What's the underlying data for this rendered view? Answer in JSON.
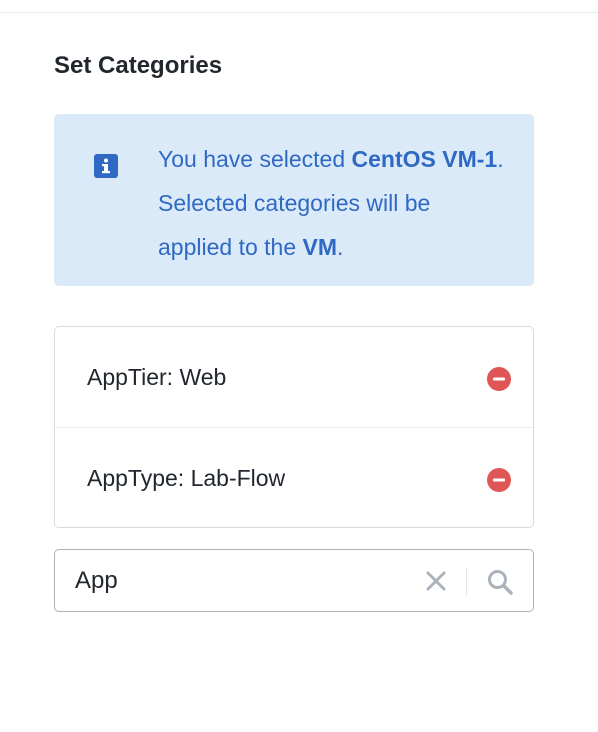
{
  "panel": {
    "title": "Set Categories"
  },
  "info": {
    "icon": "info-icon",
    "text_part1": "You have selected ",
    "vm_name": "CentOS VM-1",
    "text_part2": ". Selected categories will be applied to the ",
    "entity_type": "VM",
    "text_part3": ".",
    "background_color": "#daeaf9",
    "text_color": "#2f69c4"
  },
  "categories": [
    {
      "label": "AppTier: Web",
      "remove_icon": "remove-circle-icon"
    },
    {
      "label": "AppType: Lab-Flow",
      "remove_icon": "remove-circle-icon"
    }
  ],
  "search": {
    "value": "App",
    "clear_icon": "clear-x-icon",
    "search_icon": "magnifier-icon"
  },
  "colors": {
    "remove": "#e05555",
    "icon_gray": "#aab2bb"
  }
}
